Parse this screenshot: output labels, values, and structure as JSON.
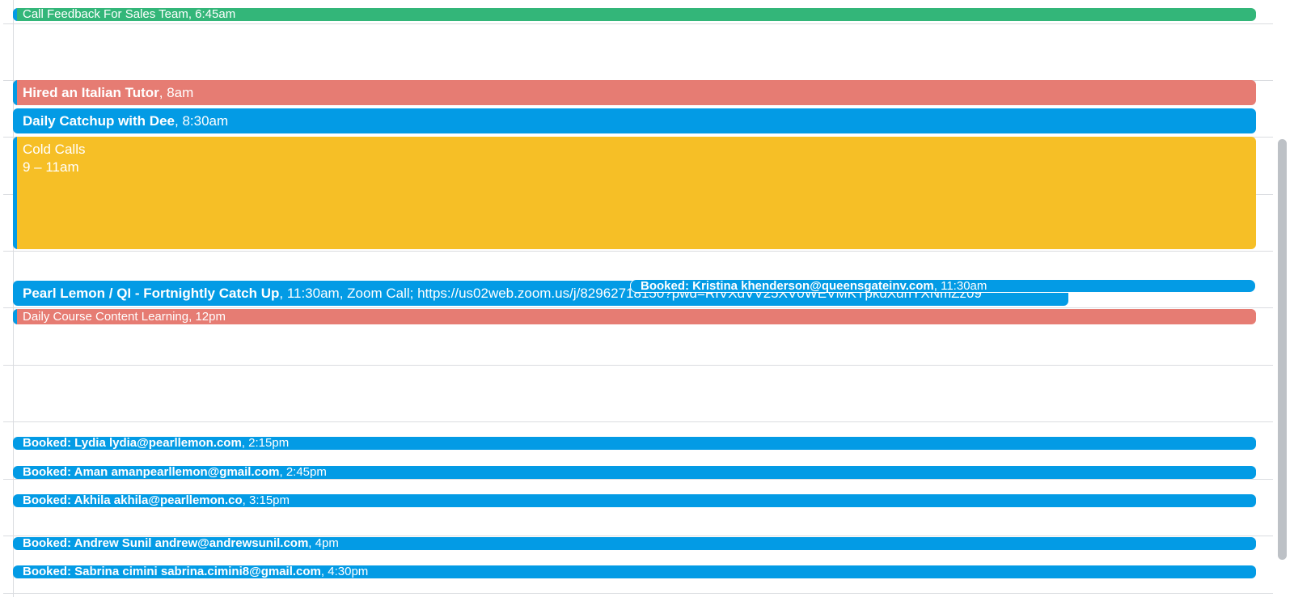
{
  "colors": {
    "green": "#33b679",
    "red": "#e67c73",
    "blue": "#039be5",
    "yellow": "#f6bf26"
  },
  "events": {
    "call_feedback": {
      "title": "Call Feedback For Sales Team",
      "time": "6:45am"
    },
    "italian_tutor": {
      "title": "Hired an Italian Tutor",
      "time": "8am"
    },
    "daily_catchup": {
      "title": "Daily Catchup with Dee",
      "time": "8:30am"
    },
    "cold_calls": {
      "title": "Cold Calls",
      "time": "9 – 11am"
    },
    "pearl_lemon": {
      "title": "Pearl Lemon / QI - Fortnightly Catch Up",
      "details": "11:30am, Zoom Call; https://us02web.zoom.us/j/82962718150?pwd=RIVXdVV25XV0WEVMKTpkdXdnYXNmZz09"
    },
    "kristina": {
      "title": "Booked: Kristina khenderson@queensgateinv.com",
      "time": "11:30am"
    },
    "course_content": {
      "title": "Daily Course Content Learning",
      "time": "12pm"
    },
    "lydia": {
      "title": "Booked: Lydia lydia@pearllemon.com",
      "time": "2:15pm"
    },
    "aman": {
      "title": "Booked: Aman amanpearllemon@gmail.com",
      "time": "2:45pm"
    },
    "akhila": {
      "title": "Booked: Akhila akhila@pearllemon.co",
      "time": "3:15pm"
    },
    "andrew": {
      "title": "Booked: Andrew Sunil andrew@andrewsunil.com",
      "time": "4pm"
    },
    "sabrina": {
      "title": "Booked: Sabrina cimini sabrina.cimini8@gmail.com",
      "time": "4:30pm"
    }
  }
}
